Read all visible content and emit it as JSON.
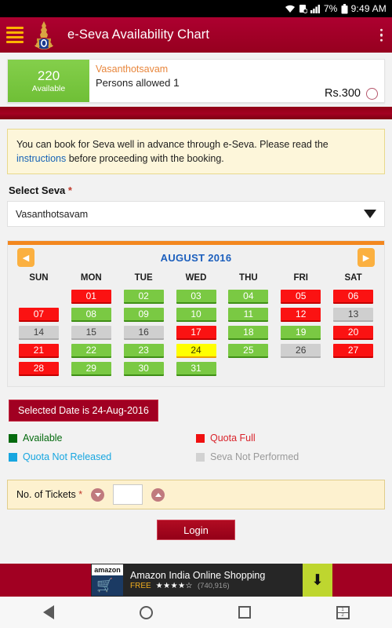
{
  "status_bar": {
    "wifi_icon": "wifi-icon",
    "sync_icon": "sync-icon",
    "signal_icon": "signal-icon",
    "battery_percent": "7%",
    "battery_icon": "battery-icon",
    "time": "9:49 AM"
  },
  "app_bar": {
    "menu_icon": "hamburger-menu-icon",
    "logo_icon": "temple-logo-icon",
    "title": "e-Seva Availability Chart",
    "overflow_icon": "kebab-menu-icon"
  },
  "availability_card": {
    "count": "220",
    "count_label": "Available",
    "seva_name": "Vasanthotsavam",
    "persons_allowed_label": "Persons allowed",
    "persons_allowed_value": "1",
    "price": "Rs.300",
    "radio_icon": "radio-button-icon",
    "badge_color": "#7ac943"
  },
  "notice": {
    "text_before": "You can book for Seva well in advance through e-Seva. Please read the ",
    "link": "instructions",
    "text_after": " before proceeding with the booking."
  },
  "select_seva": {
    "label": "Select Seva",
    "required_mark": "*",
    "value": "Vasanthotsavam",
    "caret_icon": "chevron-down-icon"
  },
  "calendar": {
    "prev_icon": "chevron-left-icon",
    "next_icon": "chevron-right-icon",
    "title": "AUGUST 2016",
    "day_names": [
      "SUN",
      "MON",
      "TUE",
      "WED",
      "THU",
      "FRI",
      "SAT"
    ],
    "weeks": [
      [
        {
          "label": "",
          "state": "empty"
        },
        {
          "label": "01",
          "state": "red"
        },
        {
          "label": "02",
          "state": "green"
        },
        {
          "label": "03",
          "state": "green"
        },
        {
          "label": "04",
          "state": "green"
        },
        {
          "label": "05",
          "state": "red"
        },
        {
          "label": "06",
          "state": "red"
        }
      ],
      [
        {
          "label": "07",
          "state": "red"
        },
        {
          "label": "08",
          "state": "green"
        },
        {
          "label": "09",
          "state": "green"
        },
        {
          "label": "10",
          "state": "green"
        },
        {
          "label": "11",
          "state": "green"
        },
        {
          "label": "12",
          "state": "red"
        },
        {
          "label": "13",
          "state": "grey"
        }
      ],
      [
        {
          "label": "14",
          "state": "grey"
        },
        {
          "label": "15",
          "state": "grey"
        },
        {
          "label": "16",
          "state": "grey"
        },
        {
          "label": "17",
          "state": "red"
        },
        {
          "label": "18",
          "state": "green"
        },
        {
          "label": "19",
          "state": "green"
        },
        {
          "label": "20",
          "state": "red"
        }
      ],
      [
        {
          "label": "21",
          "state": "red"
        },
        {
          "label": "22",
          "state": "green"
        },
        {
          "label": "23",
          "state": "green"
        },
        {
          "label": "24",
          "state": "yellow"
        },
        {
          "label": "25",
          "state": "green"
        },
        {
          "label": "26",
          "state": "grey"
        },
        {
          "label": "27",
          "state": "red"
        }
      ],
      [
        {
          "label": "28",
          "state": "red"
        },
        {
          "label": "29",
          "state": "green"
        },
        {
          "label": "30",
          "state": "green"
        },
        {
          "label": "31",
          "state": "green"
        },
        {
          "label": "",
          "state": "empty"
        },
        {
          "label": "",
          "state": "empty"
        },
        {
          "label": "",
          "state": "empty"
        }
      ]
    ]
  },
  "selected_date": "Selected Date is 24-Aug-2016",
  "legend": [
    {
      "label": "Available",
      "color": "#046a0e",
      "swatch": "sw-green",
      "text": "lg-green"
    },
    {
      "label": "Quota Full",
      "color": "#d9232b",
      "swatch": "sw-red",
      "text": "lg-red"
    },
    {
      "label": "Quota Not Released",
      "color": "#17a6e0",
      "swatch": "sw-blue",
      "text": "lg-blue"
    },
    {
      "label": "Seva Not Performed",
      "color": "#9a9a9a",
      "swatch": "sw-grey",
      "text": "lg-grey"
    }
  ],
  "tickets": {
    "label": "No. of Tickets",
    "required_mark": "*",
    "decrement_icon": "chevron-down-circle-icon",
    "increment_icon": "chevron-up-circle-icon",
    "value": "",
    "placeholder": ""
  },
  "login_button": "Login",
  "ad": {
    "brand": "amazon",
    "cart_icon": "shopping-cart-icon",
    "title": "Amazon India Online Shopping",
    "free_label": "FREE",
    "stars": "★★★★☆",
    "rating_count": "(740,916)",
    "download_icon": "download-icon"
  },
  "nav_bar": {
    "back_icon": "back-triangle-icon",
    "home_icon": "home-circle-icon",
    "recents_icon": "recents-square-icon",
    "split_icon": "split-screen-icon",
    "split_top": "1",
    "split_bottom": "2"
  }
}
